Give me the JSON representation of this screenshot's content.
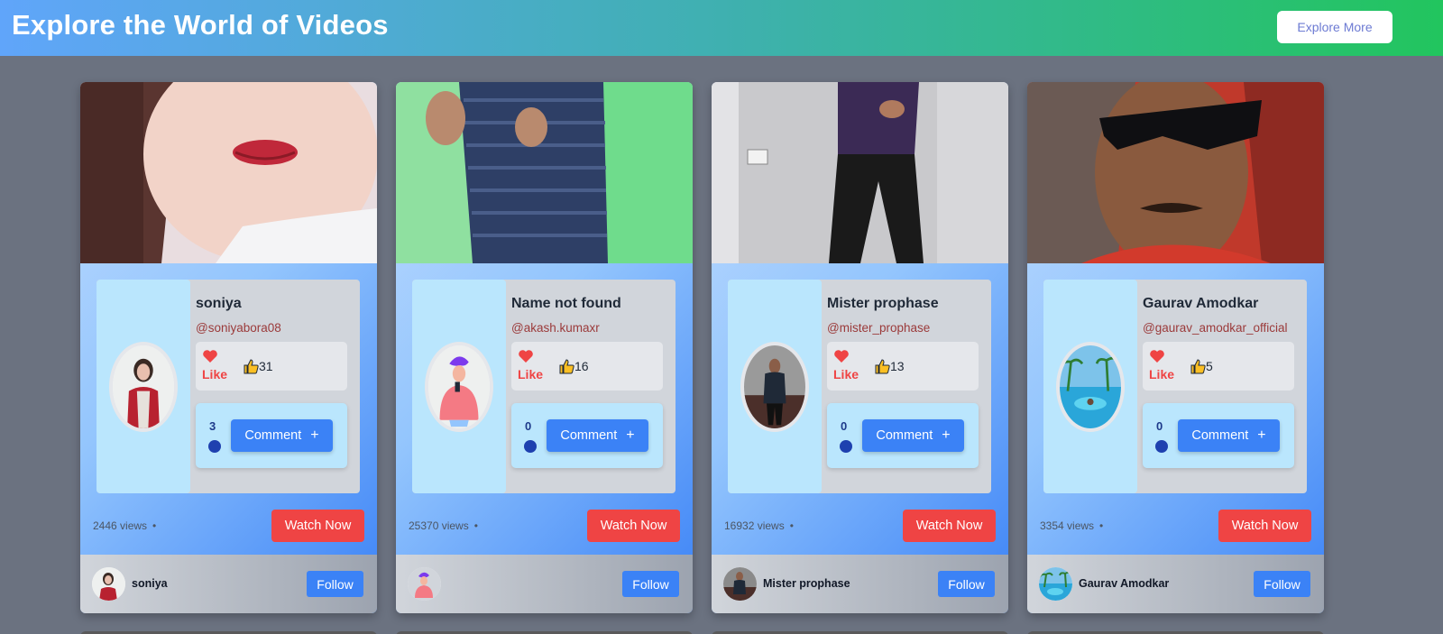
{
  "header": {
    "title": "Explore the World of Videos",
    "explore_button": "Explore More"
  },
  "colors": {
    "accent": "#3b82f6",
    "watch": "#ef4444",
    "like": "#ef4444",
    "page_bg": "#6b7280"
  },
  "cards": [
    {
      "name": "soniya",
      "handle": "@soniyabora08",
      "like_label": "Like",
      "likes": "31",
      "comments": "3",
      "comment_button": "Comment",
      "views": "2446 views",
      "views_separator": "•",
      "watch_button": "Watch Now",
      "footer_name": "soniya",
      "follow_button": "Follow"
    },
    {
      "name": "Name not found",
      "handle": "@akash.kumaxr",
      "like_label": "Like",
      "likes": "16",
      "comments": "0",
      "comment_button": "Comment",
      "views": "25370 views",
      "views_separator": "•",
      "watch_button": "Watch Now",
      "footer_name": "",
      "follow_button": "Follow"
    },
    {
      "name": "Mister prophase",
      "handle": "@mister_prophase",
      "like_label": "Like",
      "likes": "13",
      "comments": "0",
      "comment_button": "Comment",
      "views": "16932 views",
      "views_separator": "•",
      "watch_button": "Watch Now",
      "footer_name": "Mister prophase",
      "follow_button": "Follow"
    },
    {
      "name": "Gaurav Amodkar",
      "handle": "@gaurav_amodkar_official",
      "like_label": "Like",
      "likes": "5",
      "comments": "0",
      "comment_button": "Comment",
      "views": "3354 views",
      "views_separator": "•",
      "watch_button": "Watch Now",
      "footer_name": "Gaurav Amodkar",
      "follow_button": "Follow"
    }
  ]
}
